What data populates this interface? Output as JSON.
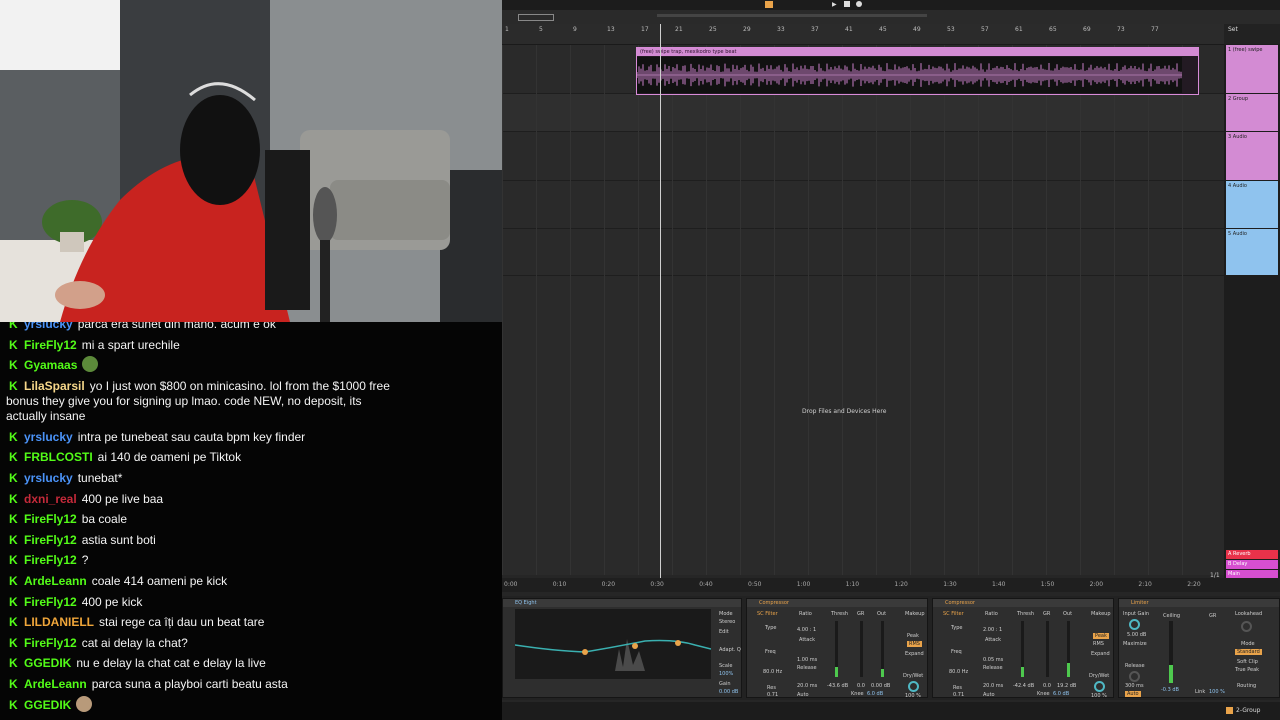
{
  "chat": {
    "messages": [
      {
        "user": "yrslucky",
        "color": "#4b93f8",
        "text": "parca era sunet din mano. acum e ok"
      },
      {
        "user": "FireFly12",
        "color": "#53fc18",
        "text": "mi a spart urechile"
      },
      {
        "user": "Gyamaas",
        "color": "#53fc18",
        "text": "",
        "emote": "frog-emote"
      },
      {
        "user": "LilaSparsil",
        "color": "#f6d78a",
        "text": "yo I just won $800 on minicasino. lol from the $1000 free bonus they give you for signing up lmao. code NEW, no deposit, its actually insane",
        "long": true
      },
      {
        "user": "yrslucky",
        "color": "#4b93f8",
        "text": "intra pe tunebeat sau cauta bpm key finder"
      },
      {
        "user": "FRBLCOSTI",
        "color": "#53fc18",
        "text": "ai 140 de oameni pe Tiktok"
      },
      {
        "user": "yrslucky",
        "color": "#4b93f8",
        "text": "tunebat*"
      },
      {
        "user": "dxni_real",
        "color": "#c42a3a",
        "text": "400 pe live baa"
      },
      {
        "user": "FireFly12",
        "color": "#53fc18",
        "text": "ba coale"
      },
      {
        "user": "FireFly12",
        "color": "#53fc18",
        "text": "astia sunt boti"
      },
      {
        "user": "FireFly12",
        "color": "#53fc18",
        "text": "?"
      },
      {
        "user": "ArdeLeann",
        "color": "#53fc18",
        "text": "coale 414 oameni pe kick"
      },
      {
        "user": "FireFly12",
        "color": "#53fc18",
        "text": "400 pe kick"
      },
      {
        "user": "LILDANIELL",
        "color": "#f0a63a",
        "text": "stai rege ca îți dau un beat tare"
      },
      {
        "user": "FireFly12",
        "color": "#53fc18",
        "text": "cat ai delay la chat?"
      },
      {
        "user": "GGEDIK",
        "color": "#53fc18",
        "text": "nu e delay la chat cat e delay la live"
      },
      {
        "user": "ArdeLeann",
        "color": "#53fc18",
        "text": "parca suna a playboi carti beatu asta"
      },
      {
        "user": "GGEDIK",
        "color": "#53fc18",
        "text": "",
        "emote": "cat-emote"
      }
    ]
  },
  "daw": {
    "ruler_bars": [
      "1",
      "5",
      "9",
      "13",
      "17",
      "21",
      "25",
      "29",
      "33",
      "37",
      "41",
      "45",
      "49",
      "53",
      "57",
      "61",
      "65",
      "69",
      "73",
      "77"
    ],
    "clip_name": "(free) swipe trap, mexikodro type beat",
    "tracks": [
      {
        "label": "1 (free) swipe",
        "color": "#d38bd3"
      },
      {
        "label": "2 Group",
        "color": "#d38bd3"
      },
      {
        "label": "3 Audio",
        "color": "#d38bd3"
      },
      {
        "label": "4 Audio",
        "color": "#8fc3ee"
      },
      {
        "label": "5 Audio",
        "color": "#8fc3ee"
      }
    ],
    "returns": [
      {
        "label": "A Reverb",
        "color": "#e8324a"
      },
      {
        "label": "B Delay",
        "color": "#d64fd0"
      },
      {
        "label": "Main",
        "color": "#d64fd0"
      }
    ],
    "drop_text": "Drop Files and Devices Here",
    "time_labels": [
      "0:00",
      "0:10",
      "0:20",
      "0:30",
      "0:40",
      "0:50",
      "1:00",
      "1:10",
      "1:20",
      "1:30",
      "1:40",
      "1:50",
      "2:00",
      "2:10",
      "2:20"
    ],
    "page_indicator": "1/1",
    "set_label": "Set",
    "devices": {
      "eq": {
        "title": "EQ Eight",
        "mode_label": "Mode",
        "mode_value": "Stereo",
        "edit": "Edit",
        "adapt": "Adapt. Q",
        "scale": "Scale",
        "scale_value": "100%",
        "gain": "Gain",
        "gain_value": "0.00 dB"
      },
      "comp1": {
        "title": "Compressor",
        "ratio": "Ratio",
        "ratio_value": "4.00 : 1",
        "attack": "Attack",
        "attack_value": "1.00 ms",
        "release": "Release",
        "release_value": "20.0 ms",
        "thresh": "Thresh",
        "gr": "GR",
        "out": "Out",
        "thresh_value": "-43.6 dB",
        "gr_value": "0.0",
        "out_value": "0.00 dB",
        "makeup": "Makeup",
        "peak": "Peak",
        "rms": "RMS",
        "expand": "Expand",
        "drywet": "Dry/Wet",
        "drywet_value": "100 %",
        "knee": "Knee",
        "knee_value": "6.0 dB",
        "auto": "Auto",
        "type": "Type",
        "freq": "Freq",
        "freq_value": "80.0 Hz",
        "res": "Res",
        "res_value": "0.71",
        "sc": "SC Filter"
      },
      "comp2": {
        "title": "Compressor",
        "ratio_value": "2.00 : 1",
        "attack_value": "0.05 ms",
        "release_value": "20.0 ms",
        "thresh_value": "-42.4 dB",
        "gr_value": "0.0",
        "out_value": "19.2 dB",
        "drywet_value": "100 %",
        "knee_value": "6.0 dB",
        "freq_value": "80.0 Hz",
        "res_value": "0.71"
      },
      "limiter": {
        "title": "Limiter",
        "input_gain": "Input Gain",
        "input_gain_value": "5.00 dB",
        "maximize": "Maximize",
        "release": "Release",
        "release_value": "300 ms",
        "auto": "Auto",
        "ceiling": "Ceiling",
        "ceiling_value": "-0.3 dB",
        "gr": "GR",
        "link": "Link",
        "link_value": "100 %",
        "lookahead": "Lookahead",
        "mode": "Mode",
        "mode_value": "Standard",
        "soft_clip": "Soft Clip",
        "true_peak": "True Peak",
        "routing": "Routing"
      }
    },
    "bottom_track": "2-Group"
  }
}
